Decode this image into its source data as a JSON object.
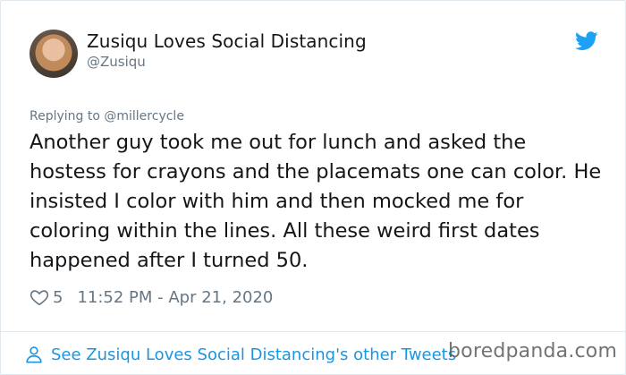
{
  "tweet": {
    "display_name": "Zusiqu Loves Social Distancing",
    "handle": "@Zusiqu",
    "replying_to": "Replying to @millercycle",
    "text": "Another guy took me out for lunch and asked the hostess for crayons and the placemats one can color. He insisted I color with him and then mocked me for coloring within the lines. All these weird first dates happened after I turned 50.",
    "like_count": "5",
    "timestamp": "11:52 PM - Apr 21, 2020"
  },
  "footer": {
    "link_label": "See Zusiqu Loves Social Distancing's other Tweets"
  },
  "watermark": "boredpanda.com",
  "icons": {
    "brand": "twitter-bird-icon",
    "like": "heart-icon",
    "profile": "person-icon"
  },
  "colors": {
    "accent": "#1da1f2",
    "link": "#1b95e0",
    "muted": "#657786",
    "text": "#14171a",
    "border": "#e1e8ed"
  }
}
